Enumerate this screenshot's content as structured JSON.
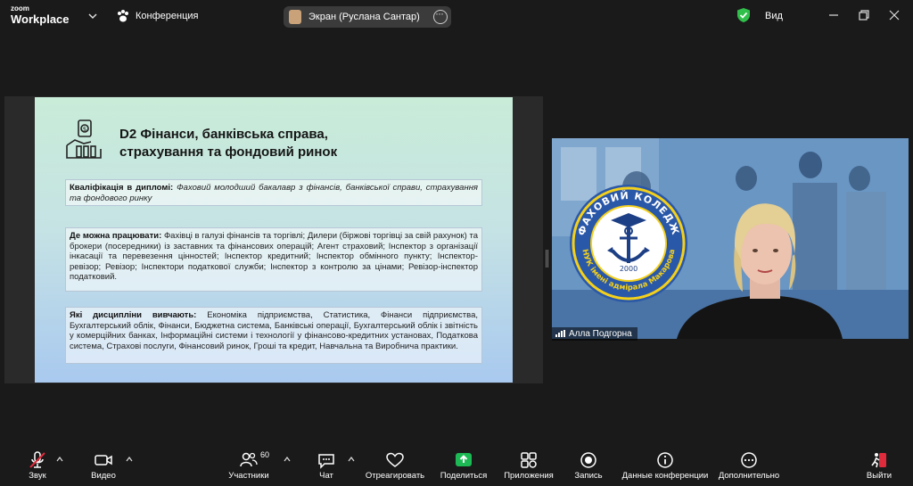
{
  "titlebar": {
    "logo_line1": "zoom",
    "logo_line2": "Workplace",
    "meeting_label": "Конференция",
    "share_label": "Экран (Руслана Сантар)",
    "view_label": "Вид",
    "accent_green": "#2fbf4a"
  },
  "slide": {
    "title_line1": "D2 Фінанси, банківська справа,",
    "title_line2": "страхування та фондовий ринок",
    "qualification_heading": "Кваліфікація в дипломі:",
    "qualification_text": "Фаховий молодший бакалавр з фінансів, банківської справи, страхування та фондового ринку",
    "work_heading": "Де можна працювати:",
    "work_text": "Фахівці в галузі фінансів та торгівлі;  Дилери (біржові торгівці за свій рахунок) та брокери (посередники) із заставних та фінансових операцій; Агент страховий; Інспектор з організації інкасації та перевезення цінностей;  Інспектор кредитний; Інспектор обмінного пункту; Інспектор-ревізор; Ревізор; Інспектори податкової служби; Інспектор з контролю за цінами; Ревізор-інспектор податковий.",
    "disciplines_heading": "Які дисципліни вивчають:",
    "disciplines_text": "Економіка підприємства, Статистика, Фінанси підприємства, Бухгалтерський облік, Фінанси, Бюджетна система, Банківські операції, Бухгалтерський облік і звітність у комерційних банках, Інформаційні системи і технології у фінансово-кредитних установах, Податкова система, Страхові послуги, Фінансовий ринок, Гроші та кредит, Навчальна та Виробнича практики."
  },
  "video": {
    "college_name": "ФАХОВИЙ КОЛЕДЖ",
    "college_subtitle": "НУК імені адмірала Макарова",
    "year": "2000",
    "speaker_name": "Алла Подгорна"
  },
  "toolbar": {
    "audio": "Звук",
    "video": "Видео",
    "participants": "Участники",
    "participants_count": "60",
    "chat": "Чат",
    "react": "Отреагировать",
    "share": "Поделиться",
    "apps": "Приложения",
    "record": "Запись",
    "info": "Данные конференции",
    "more": "Дополнительно",
    "leave": "Выйти",
    "share_color": "#1db954",
    "leave_color": "#e02b3c"
  }
}
